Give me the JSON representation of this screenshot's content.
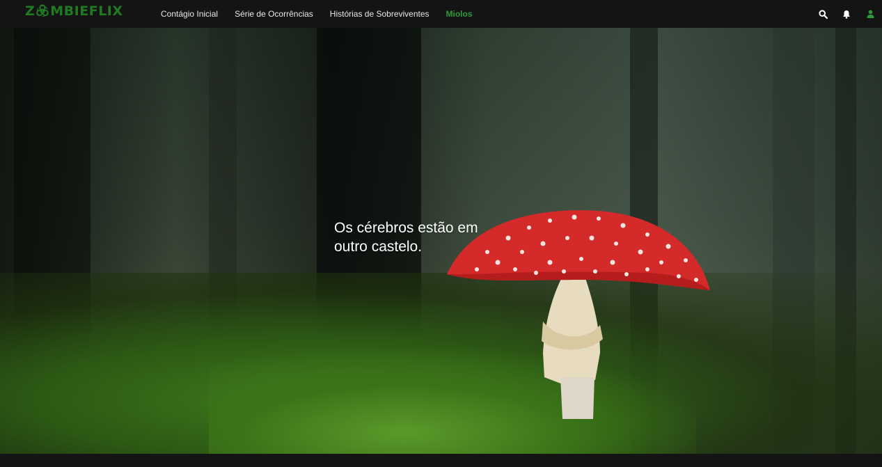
{
  "brand": {
    "logo_text_before": "Z",
    "logo_text_after": "MBIEFLIX",
    "logo_icon": "biohazard-icon",
    "color": "#1f7a22"
  },
  "nav": {
    "items": [
      {
        "label": "Contágio Inicial",
        "active": false
      },
      {
        "label": "Série de Ocorrências",
        "active": false
      },
      {
        "label": "Histórias de Sobreviventes",
        "active": false
      },
      {
        "label": "Miolos",
        "active": true
      }
    ],
    "active_color": "#2f9a3a",
    "icons": [
      "search-icon",
      "bell-icon",
      "user-icon"
    ]
  },
  "hero": {
    "headline": "Os cérebros estão em outro castelo."
  }
}
